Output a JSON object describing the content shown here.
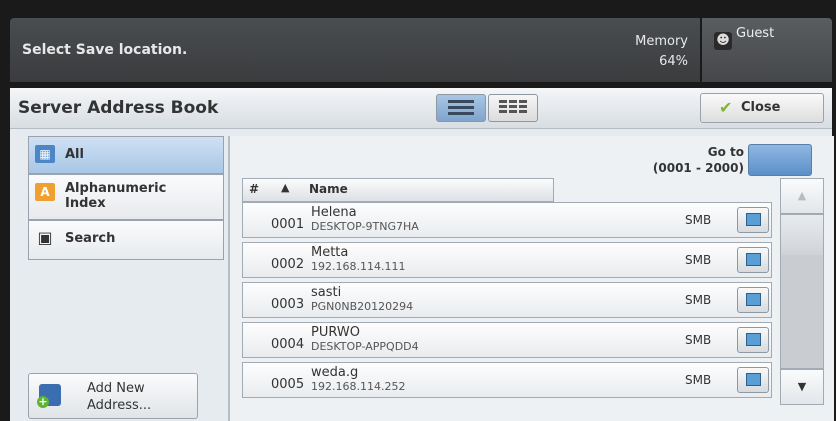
{
  "topbar": {
    "message": "Select Save location.",
    "memory_label": "Memory",
    "memory_value": "64%"
  },
  "user": {
    "label": "Guest",
    "icon": "user-icon"
  },
  "header": {
    "title": "Server Address Book",
    "close_label": "Close"
  },
  "sidebar": {
    "items": [
      {
        "label": "All",
        "icon": "all-icon"
      },
      {
        "label": "Alphanumeric Index",
        "icon": "alpha-index-icon",
        "icon_text": "A"
      },
      {
        "label": "Search",
        "icon": "binoculars-icon"
      }
    ],
    "add_new": "Add New Address..."
  },
  "goto": {
    "label": "Go to",
    "range": "(0001 - 2000)"
  },
  "columns": {
    "hash": "#",
    "name": "Name"
  },
  "rows": [
    {
      "num": "0001",
      "name": "Helena",
      "host": "DESKTOP-9TNG7HA",
      "protocol": "SMB"
    },
    {
      "num": "0002",
      "name": "Metta",
      "host": "192.168.114.111",
      "protocol": "SMB"
    },
    {
      "num": "0003",
      "name": "sasti",
      "host": "PGN0NB20120294",
      "protocol": "SMB"
    },
    {
      "num": "0004",
      "name": "PURWO",
      "host": "DESKTOP-APPQDD4",
      "protocol": "SMB"
    },
    {
      "num": "0005",
      "name": "weda.g",
      "host": "192.168.114.252",
      "protocol": "SMB"
    }
  ],
  "colors": {
    "accent": "#7fa4cc",
    "header_bg": "#3a3c3e",
    "panel_bg": "#e6ebf0"
  }
}
